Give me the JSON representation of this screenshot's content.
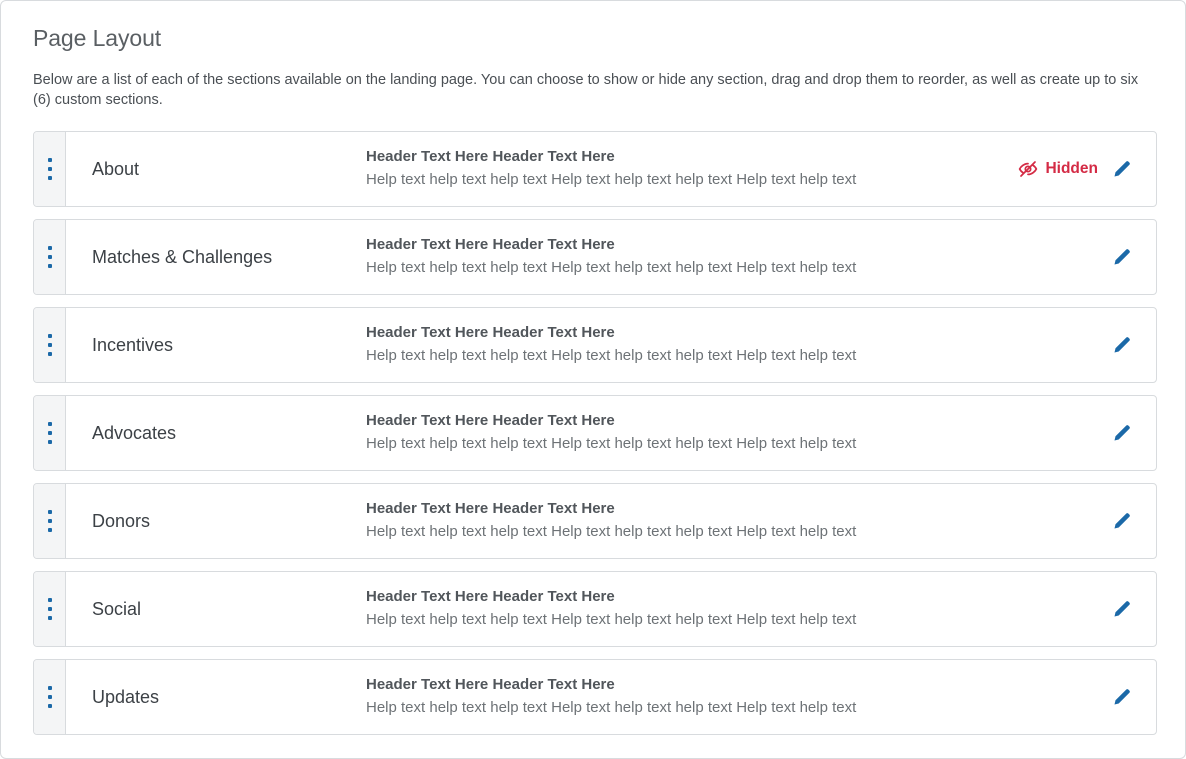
{
  "page": {
    "title": "Page Layout",
    "description": "Below are a list of each of the sections available on the landing page. You can choose to show or hide any section, drag and drop them to reorder, as well as create up to six (6) custom sections."
  },
  "colors": {
    "accent_blue": "#1b69a8",
    "hidden_red": "#d42b45",
    "border_gray": "#d8dbde",
    "handle_bg": "#f4f5f6",
    "title_gray": "#5a5f63"
  },
  "icons": {
    "drag_handle": "drag-handle-dots-icon",
    "hidden": "eye-slash-icon",
    "edit": "pencil-icon"
  },
  "sections": [
    {
      "name": "About",
      "header_text": "Header Text Here Header Text Here",
      "help_text": "Help text help text help text Help text help text help text Help text help text",
      "hidden": true,
      "hidden_label": "Hidden",
      "edit_label": "Edit"
    },
    {
      "name": "Matches & Challenges",
      "header_text": "Header Text Here Header Text Here",
      "help_text": "Help text help text help text Help text help text help text Help text help text",
      "hidden": false,
      "hidden_label": "",
      "edit_label": "Edit"
    },
    {
      "name": "Incentives",
      "header_text": "Header Text Here Header Text Here",
      "help_text": "Help text help text help text Help text help text help text Help text help text",
      "hidden": false,
      "hidden_label": "",
      "edit_label": "Edit"
    },
    {
      "name": "Advocates",
      "header_text": "Header Text Here Header Text Here",
      "help_text": "Help text help text help text Help text help text help text Help text help text",
      "hidden": false,
      "hidden_label": "",
      "edit_label": "Edit"
    },
    {
      "name": "Donors",
      "header_text": "Header Text Here Header Text Here",
      "help_text": "Help text help text help text Help text help text help text Help text help text",
      "hidden": false,
      "hidden_label": "",
      "edit_label": "Edit"
    },
    {
      "name": "Social",
      "header_text": "Header Text Here Header Text Here",
      "help_text": "Help text help text help text Help text help text help text Help text help text",
      "hidden": false,
      "hidden_label": "",
      "edit_label": "Edit"
    },
    {
      "name": "Updates",
      "header_text": "Header Text Here Header Text Here",
      "help_text": "Help text help text help text Help text help text help text Help text help text",
      "hidden": false,
      "hidden_label": "",
      "edit_label": "Edit"
    }
  ]
}
